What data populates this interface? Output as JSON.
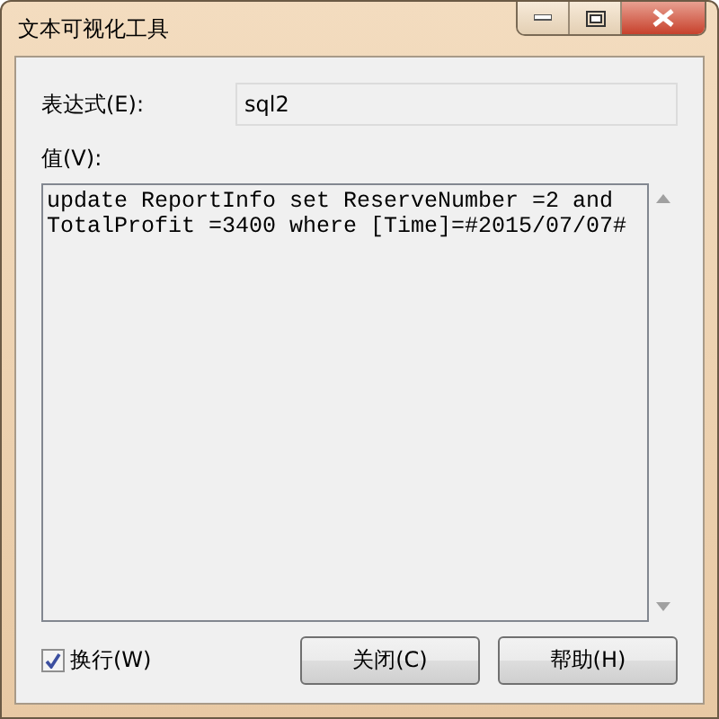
{
  "window": {
    "title": "文本可视化工具"
  },
  "expression": {
    "label": "表达式(E):",
    "value": "sql2"
  },
  "value": {
    "label": "值(V):",
    "text": "update ReportInfo set ReserveNumber =2 and TotalProfit =3400 where [Time]=#2015/07/07#"
  },
  "wrap": {
    "label": "换行(W)",
    "checked": true
  },
  "buttons": [
    "关闭(C)",
    "帮助(H)"
  ]
}
